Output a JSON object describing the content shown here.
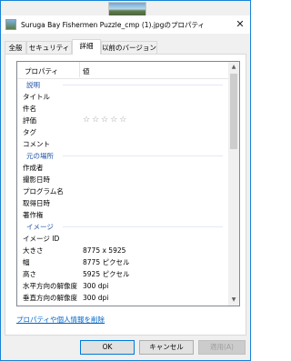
{
  "window": {
    "title": "Suruga Bay Fishermen Puzzle_cmp (1).jpgのプロパティ",
    "close_glyph": "✕"
  },
  "tabs": [
    {
      "label": "全般",
      "active": false
    },
    {
      "label": "セキュリティ",
      "active": false
    },
    {
      "label": "詳細",
      "active": true
    },
    {
      "label": "以前のバージョン",
      "active": false
    }
  ],
  "list": {
    "col_property": "プロパティ",
    "col_value": "値",
    "group_description": "説明",
    "group_origin": "元の場所",
    "group_image": "イメージ",
    "rows_description": [
      {
        "name": "タイトル",
        "value": ""
      },
      {
        "name": "件名",
        "value": ""
      },
      {
        "name": "評価",
        "value": "☆☆☆☆☆",
        "rating": 0
      },
      {
        "name": "タグ",
        "value": ""
      },
      {
        "name": "コメント",
        "value": ""
      }
    ],
    "rows_origin": [
      {
        "name": "作成者",
        "value": ""
      },
      {
        "name": "撮影日時",
        "value": ""
      },
      {
        "name": "プログラム名",
        "value": ""
      },
      {
        "name": "取得日時",
        "value": ""
      },
      {
        "name": "著作権",
        "value": ""
      }
    ],
    "rows_image": [
      {
        "name": "イメージ ID",
        "value": ""
      },
      {
        "name": "大きさ",
        "value": "8775 x 5925"
      },
      {
        "name": "幅",
        "value": "8775 ピクセル"
      },
      {
        "name": "高さ",
        "value": "5925 ピクセル"
      },
      {
        "name": "水平方向の解像度",
        "value": "300 dpi"
      },
      {
        "name": "垂直方向の解像度",
        "value": "300 dpi"
      }
    ]
  },
  "remove_link": "プロパティや個人情報を削除",
  "buttons": {
    "ok": "OK",
    "cancel": "キャンセル",
    "apply": "適用(A)"
  },
  "colors": {
    "accent": "#0078d7",
    "group_text": "#1e51a4",
    "link": "#0066cc"
  }
}
